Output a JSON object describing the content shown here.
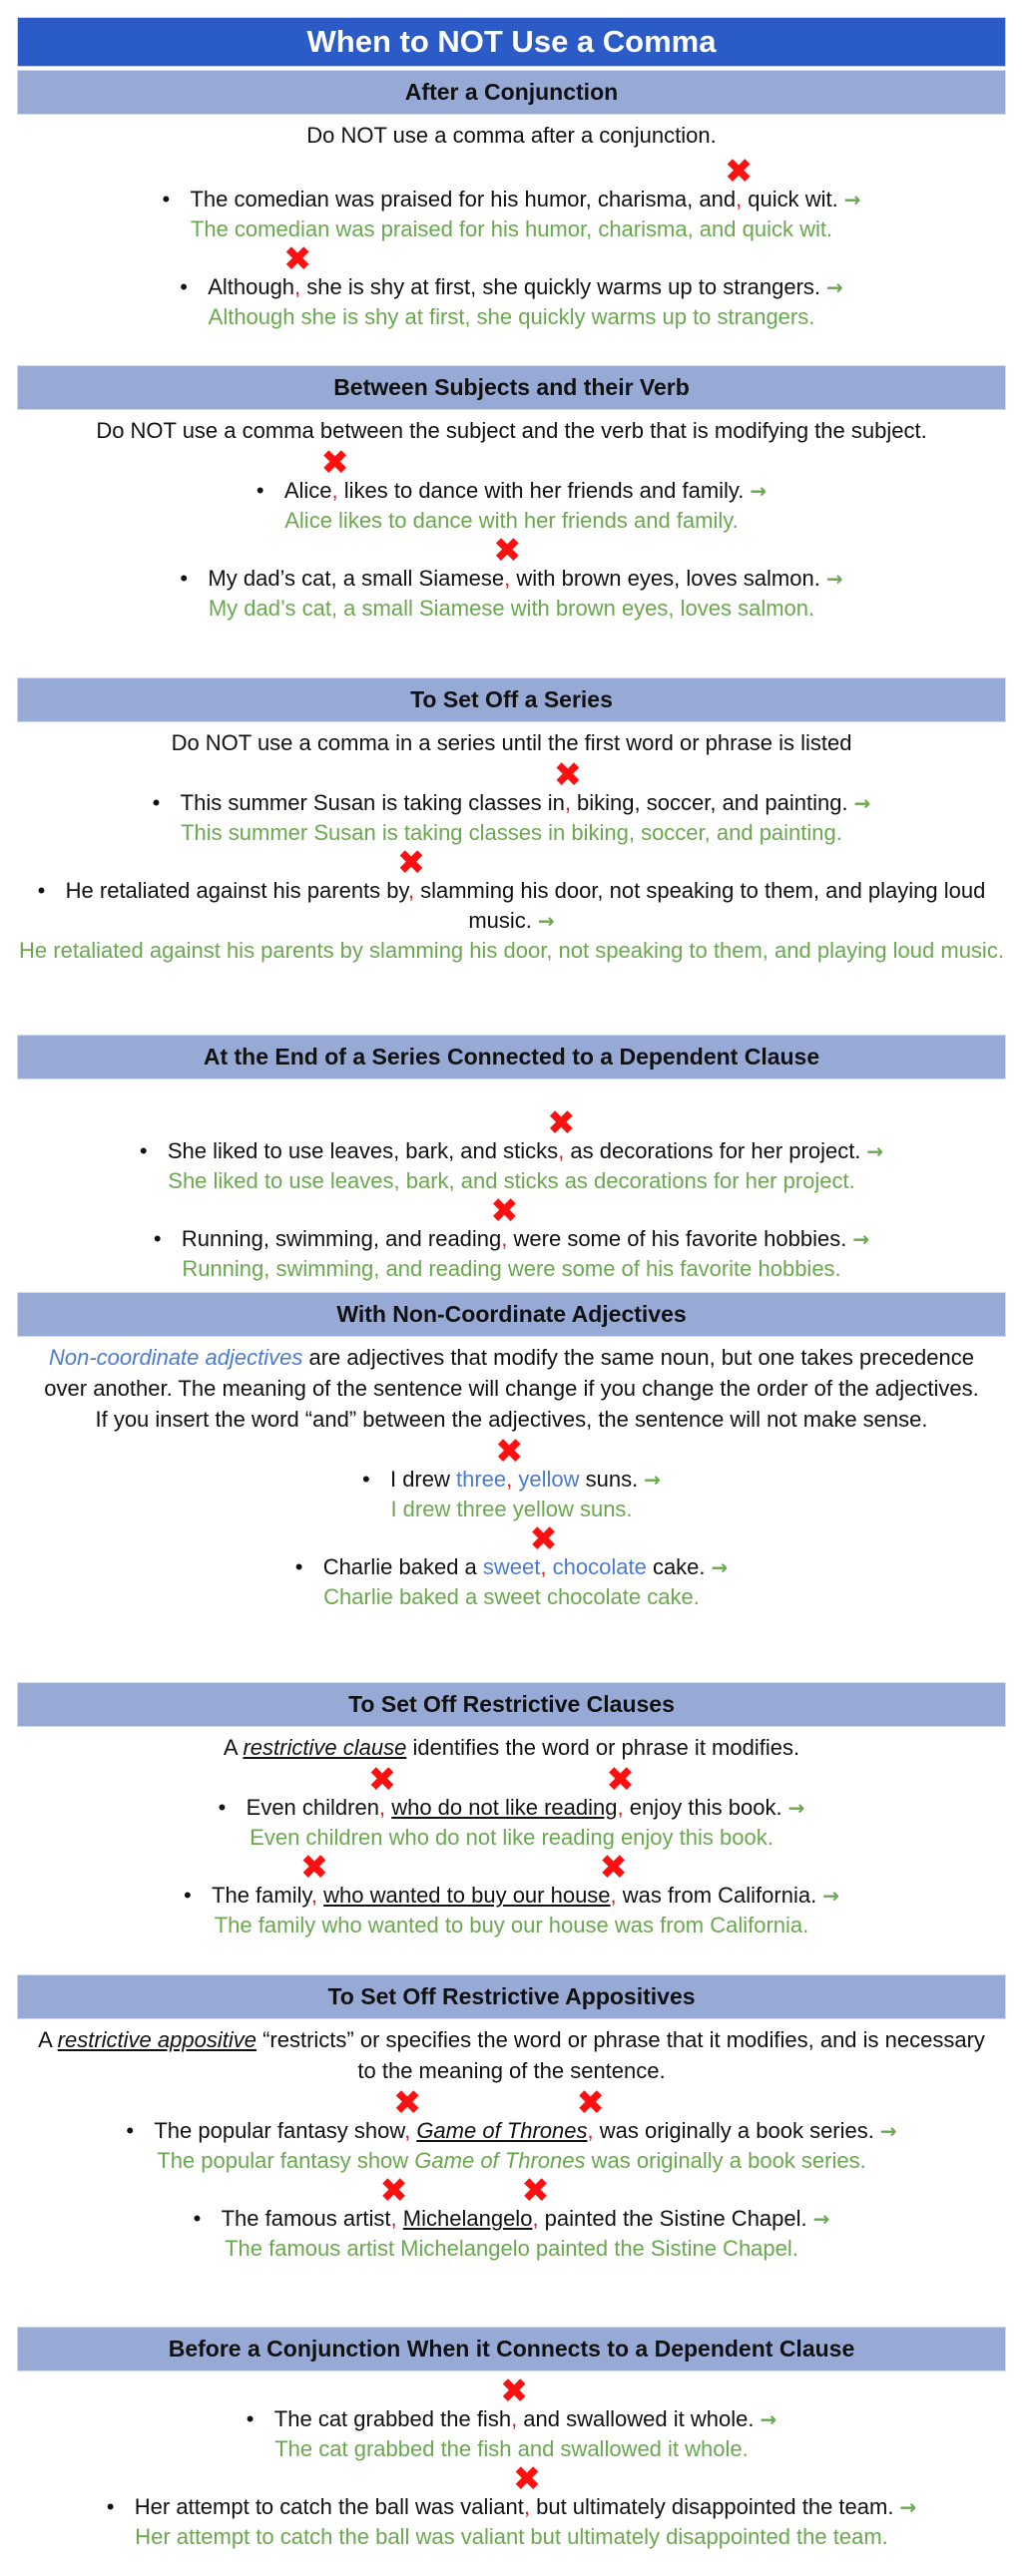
{
  "title": "When to NOT Use a Comma",
  "colors": {
    "title_bg": "#2b5bc6",
    "section_bg": "#97aad6",
    "wrong_comma": "#e0201a",
    "x_mark": "#ff1010",
    "correct_text": "#6aa84f",
    "highlight_blue": "#4a7bd0"
  },
  "icons": {
    "x_mark": "✖",
    "arrow": "→",
    "bullet": "•"
  },
  "sections": [
    {
      "heading": "After a Conjunction",
      "description": [
        {
          "t": "Do NOT use a comma after a conjunction.",
          "s": "n"
        }
      ],
      "examples": [
        {
          "wrong": [
            {
              "t": "The comedian was praised for his humor, charisma, and",
              "s": "n"
            },
            {
              "t": ",",
              "s": "x"
            },
            {
              "t": " quick wit.",
              "s": "n"
            }
          ],
          "correct": "The comedian was praised for his humor, charisma, and quick wit."
        },
        {
          "wrong": [
            {
              "t": "Although",
              "s": "n"
            },
            {
              "t": ",",
              "s": "x"
            },
            {
              "t": " she is shy at first, she quickly warms up to strangers.",
              "s": "n"
            }
          ],
          "correct": "Although she is shy at first, she quickly warms up to strangers."
        }
      ]
    },
    {
      "heading": "Between Subjects and their Verb",
      "description": [
        {
          "t": "Do NOT use a comma between the subject and the verb that is modifying the subject.",
          "s": "n"
        }
      ],
      "examples": [
        {
          "wrong": [
            {
              "t": "Alice",
              "s": "n"
            },
            {
              "t": ",",
              "s": "x"
            },
            {
              "t": " likes to dance with her friends and family.",
              "s": "n"
            }
          ],
          "correct": "Alice likes to dance with her friends and family."
        },
        {
          "wrong": [
            {
              "t": "My dad’s cat, a small Siamese",
              "s": "n"
            },
            {
              "t": ",",
              "s": "x"
            },
            {
              "t": " with brown eyes, loves salmon.",
              "s": "n"
            }
          ],
          "correct": "My dad’s cat, a small Siamese with brown eyes, loves salmon."
        }
      ]
    },
    {
      "heading": "To Set Off a Series",
      "description": [
        {
          "t": "Do NOT use a comma in a series until the first word or phrase is listed",
          "s": "n"
        }
      ],
      "examples": [
        {
          "wrong": [
            {
              "t": "This summer Susan is taking classes in",
              "s": "n"
            },
            {
              "t": ",",
              "s": "x"
            },
            {
              "t": " biking, soccer, and painting.",
              "s": "n"
            }
          ],
          "correct": "This summer Susan is taking classes in biking, soccer, and painting."
        },
        {
          "wrong": [
            {
              "t": "He retaliated against his parents by",
              "s": "n"
            },
            {
              "t": ",",
              "s": "x"
            },
            {
              "t": " slamming his door, not speaking to them, and playing loud music.",
              "s": "n"
            }
          ],
          "correct": "He retaliated against his parents by slamming his door, not speaking to them, and playing loud music."
        }
      ]
    },
    {
      "heading": "At the End of a Series Connected to a Dependent Clause",
      "description": [],
      "examples": [
        {
          "wrong": [
            {
              "t": "She liked to use leaves, bark, and sticks",
              "s": "n"
            },
            {
              "t": ",",
              "s": "x"
            },
            {
              "t": " as decorations for her project.",
              "s": "n"
            }
          ],
          "correct": "She liked to use leaves, bark, and sticks as decorations for her project."
        },
        {
          "wrong": [
            {
              "t": "Running, swimming, and reading",
              "s": "n"
            },
            {
              "t": ",",
              "s": "x"
            },
            {
              "t": " were some of his favorite hobbies.",
              "s": "n"
            }
          ],
          "correct": "Running, swimming, and reading were some of his favorite hobbies."
        }
      ]
    },
    {
      "heading": "With Non-Coordinate Adjectives",
      "description": [
        {
          "t": "Non-coordinate adjectives",
          "s": "ib"
        },
        {
          "t": " are adjectives that modify the same noun, but one takes precedence over another. The meaning of the sentence will change if you change the order of the adjectives. If you insert the word “and” between the adjectives, the sentence will not make sense.",
          "s": "n"
        }
      ],
      "examples": [
        {
          "wrong": [
            {
              "t": "I drew ",
              "s": "n"
            },
            {
              "t": "three",
              "s": "b"
            },
            {
              "t": ",",
              "s": "x"
            },
            {
              "t": " ",
              "s": "n"
            },
            {
              "t": "yellow",
              "s": "b"
            },
            {
              "t": " suns.",
              "s": "n"
            }
          ],
          "correct": "I drew three yellow suns."
        },
        {
          "wrong": [
            {
              "t": "Charlie baked a ",
              "s": "n"
            },
            {
              "t": "sweet",
              "s": "b"
            },
            {
              "t": ",",
              "s": "x"
            },
            {
              "t": " ",
              "s": "n"
            },
            {
              "t": "chocolate",
              "s": "b"
            },
            {
              "t": " cake.",
              "s": "n"
            }
          ],
          "correct": "Charlie baked a sweet chocolate cake."
        }
      ]
    },
    {
      "heading": "To Set Off Restrictive Clauses",
      "description": [
        {
          "t": "A ",
          "s": "n"
        },
        {
          "t": "restrictive clause",
          "s": "iu"
        },
        {
          "t": " identifies the word or phrase it modifies.",
          "s": "n"
        }
      ],
      "examples": [
        {
          "wrong": [
            {
              "t": "Even children",
              "s": "n"
            },
            {
              "t": ",",
              "s": "x"
            },
            {
              "t": " ",
              "s": "n"
            },
            {
              "t": "who do not like reading",
              "s": "u"
            },
            {
              "t": ",",
              "s": "x"
            },
            {
              "t": " enjoy this book.",
              "s": "n"
            }
          ],
          "correct": "Even children who do not like reading enjoy this book."
        },
        {
          "wrong": [
            {
              "t": "The family",
              "s": "n"
            },
            {
              "t": ",",
              "s": "x"
            },
            {
              "t": " ",
              "s": "n"
            },
            {
              "t": "who wanted to buy our house",
              "s": "u"
            },
            {
              "t": ",",
              "s": "x"
            },
            {
              "t": " was from California.",
              "s": "n"
            }
          ],
          "correct": "The family who wanted to buy our house was from California."
        }
      ]
    },
    {
      "heading": "To Set Off Restrictive Appositives",
      "description": [
        {
          "t": "A ",
          "s": "n"
        },
        {
          "t": "restrictive appositive",
          "s": "iu"
        },
        {
          "t": " “restricts” or specifies the word or phrase that it modifies, and is necessary to the meaning of the sentence.",
          "s": "n"
        }
      ],
      "examples": [
        {
          "wrong": [
            {
              "t": "The popular fantasy show",
              "s": "n"
            },
            {
              "t": ",",
              "s": "x"
            },
            {
              "t": " ",
              "s": "n"
            },
            {
              "t": "Game of Thrones",
              "s": "iu"
            },
            {
              "t": ",",
              "s": "x"
            },
            {
              "t": " was originally a book series.",
              "s": "n"
            }
          ],
          "correct_segments": [
            {
              "t": "The popular fantasy show ",
              "s": "n"
            },
            {
              "t": "Game of Thrones",
              "s": "i"
            },
            {
              "t": " was originally a book series.",
              "s": "n"
            }
          ]
        },
        {
          "wrong": [
            {
              "t": "The famous artist",
              "s": "n"
            },
            {
              "t": ",",
              "s": "x"
            },
            {
              "t": " ",
              "s": "n"
            },
            {
              "t": "Michelangelo",
              "s": "u"
            },
            {
              "t": ",",
              "s": "x"
            },
            {
              "t": " painted the Sistine Chapel.",
              "s": "n"
            }
          ],
          "correct": "The famous artist Michelangelo painted the Sistine Chapel."
        }
      ]
    },
    {
      "heading": "Before a Conjunction When it Connects to a Dependent Clause",
      "description": [],
      "examples": [
        {
          "wrong": [
            {
              "t": "The cat grabbed the fish",
              "s": "n"
            },
            {
              "t": ",",
              "s": "x"
            },
            {
              "t": " and swallowed it whole.",
              "s": "n"
            }
          ],
          "correct": "The cat grabbed the fish and swallowed it whole."
        },
        {
          "wrong": [
            {
              "t": "Her attempt to catch the ball was valiant",
              "s": "n"
            },
            {
              "t": ",",
              "s": "x"
            },
            {
              "t": " but ultimately disappointed the team.",
              "s": "n"
            }
          ],
          "correct": "Her attempt to catch the ball was valiant but ultimately disappointed the team."
        }
      ]
    }
  ]
}
